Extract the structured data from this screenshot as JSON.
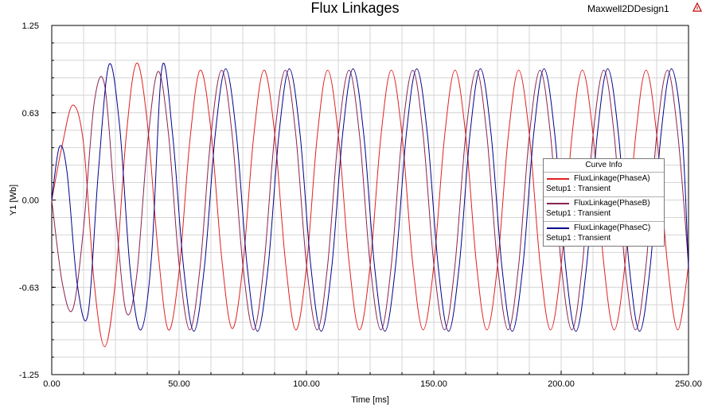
{
  "header": {
    "title": "Flux Linkages",
    "design_name": "Maxwell2DDesign1",
    "logo_icon": "ansys-triangle-icon"
  },
  "chart_data": {
    "type": "line",
    "title": "Flux Linkages",
    "xlabel": "Time [ms]",
    "ylabel": "Y1 [Wb]",
    "xlim": [
      0,
      250
    ],
    "ylim": [
      -1.25,
      1.25
    ],
    "x_ticks": [
      "0.00",
      "50.00",
      "100.00",
      "150.00",
      "200.00",
      "250.00"
    ],
    "y_ticks": [
      "1.25",
      "0.63",
      "0.00",
      "-0.63",
      "-1.25"
    ],
    "grid": true,
    "legend_position": "right",
    "legend_title": "Curve Info",
    "series": [
      {
        "name": "FluxLinkage(PhaseA)",
        "sublabel": "Setup1 : Transient",
        "color": "#e02020",
        "points": [
          [
            0,
            0.0
          ],
          [
            4.2,
            0.4
          ],
          [
            8.3,
            0.68
          ],
          [
            12.5,
            0.4
          ],
          [
            16.7,
            -0.6
          ],
          [
            20.8,
            -1.05
          ],
          [
            25,
            -0.58
          ],
          [
            29.2,
            0.45
          ],
          [
            33.3,
            0.98
          ],
          [
            37.5,
            0.56
          ],
          [
            41.7,
            -0.36
          ],
          [
            45.8,
            -0.93
          ],
          [
            50,
            -0.51
          ],
          [
            54.2,
            0.42
          ],
          [
            58.3,
            0.93
          ],
          [
            62.5,
            0.5
          ],
          [
            66.7,
            -0.41
          ],
          [
            70.8,
            -0.92
          ],
          [
            75,
            -0.48
          ],
          [
            79.2,
            0.44
          ],
          [
            83.3,
            0.93
          ],
          [
            87.5,
            0.48
          ],
          [
            91.7,
            -0.43
          ],
          [
            95.8,
            -0.93
          ],
          [
            100,
            -0.48
          ],
          [
            104.2,
            0.45
          ],
          [
            108.3,
            0.93
          ],
          [
            112.5,
            0.47
          ],
          [
            116.7,
            -0.44
          ],
          [
            120.8,
            -0.93
          ],
          [
            125,
            -0.47
          ],
          [
            129.2,
            0.45
          ],
          [
            133.3,
            0.93
          ],
          [
            137.5,
            0.47
          ],
          [
            141.7,
            -0.45
          ],
          [
            145.8,
            -0.93
          ],
          [
            150,
            -0.47
          ],
          [
            154.2,
            0.45
          ],
          [
            158.3,
            0.93
          ],
          [
            162.5,
            0.47
          ],
          [
            166.7,
            -0.45
          ],
          [
            170.8,
            -0.93
          ],
          [
            175,
            -0.47
          ],
          [
            179.2,
            0.45
          ],
          [
            183.3,
            0.93
          ],
          [
            187.5,
            0.47
          ],
          [
            191.7,
            -0.45
          ],
          [
            195.8,
            -0.93
          ],
          [
            200,
            -0.47
          ],
          [
            204.2,
            0.45
          ],
          [
            208.3,
            0.93
          ],
          [
            212.5,
            0.47
          ],
          [
            216.7,
            -0.45
          ],
          [
            220.8,
            -0.93
          ],
          [
            225,
            -0.47
          ],
          [
            229.2,
            0.45
          ],
          [
            233.3,
            0.93
          ],
          [
            237.5,
            0.47
          ],
          [
            241.7,
            -0.45
          ],
          [
            245.8,
            -0.93
          ],
          [
            250,
            -0.47
          ]
        ]
      },
      {
        "name": "FluxLinkage(PhaseB)",
        "sublabel": "Setup1 : Transient",
        "color": "#8b2252",
        "points": [
          [
            0,
            0.0
          ],
          [
            4.2,
            -0.6
          ],
          [
            8.3,
            -0.78
          ],
          [
            12.5,
            -0.2
          ],
          [
            16.7,
            0.7
          ],
          [
            20.8,
            0.82
          ],
          [
            25,
            -0.08
          ],
          [
            29.2,
            -0.8
          ],
          [
            33.3,
            -0.55
          ],
          [
            37.5,
            0.38
          ],
          [
            41.7,
            0.92
          ],
          [
            45.8,
            0.48
          ],
          [
            50,
            -0.46
          ],
          [
            54.2,
            -0.93
          ],
          [
            58.3,
            -0.47
          ],
          [
            62.5,
            0.46
          ],
          [
            66.7,
            0.93
          ],
          [
            70.8,
            0.47
          ],
          [
            75,
            -0.46
          ],
          [
            79.2,
            -0.93
          ],
          [
            83.3,
            -0.47
          ],
          [
            87.5,
            0.46
          ],
          [
            91.7,
            0.93
          ],
          [
            95.8,
            0.47
          ],
          [
            100,
            -0.46
          ],
          [
            104.2,
            -0.93
          ],
          [
            108.3,
            -0.47
          ],
          [
            112.5,
            0.46
          ],
          [
            116.7,
            0.93
          ],
          [
            120.8,
            0.47
          ],
          [
            125,
            -0.46
          ],
          [
            129.2,
            -0.93
          ],
          [
            133.3,
            -0.47
          ],
          [
            137.5,
            0.46
          ],
          [
            141.7,
            0.93
          ],
          [
            145.8,
            0.47
          ],
          [
            150,
            -0.46
          ],
          [
            154.2,
            -0.93
          ],
          [
            158.3,
            -0.47
          ],
          [
            162.5,
            0.46
          ],
          [
            166.7,
            0.93
          ],
          [
            170.8,
            0.47
          ],
          [
            175,
            -0.46
          ],
          [
            179.2,
            -0.93
          ],
          [
            183.3,
            -0.47
          ],
          [
            187.5,
            0.46
          ],
          [
            191.7,
            0.93
          ],
          [
            195.8,
            0.47
          ],
          [
            200,
            -0.46
          ],
          [
            204.2,
            -0.93
          ],
          [
            208.3,
            -0.47
          ],
          [
            212.5,
            0.46
          ],
          [
            216.7,
            0.93
          ],
          [
            220.8,
            0.47
          ],
          [
            225,
            -0.46
          ],
          [
            229.2,
            -0.93
          ],
          [
            233.3,
            -0.47
          ],
          [
            237.5,
            0.46
          ],
          [
            241.7,
            0.93
          ],
          [
            245.8,
            0.47
          ],
          [
            250,
            -0.46
          ]
        ]
      },
      {
        "name": "FluxLinkage(PhaseC)",
        "sublabel": "Setup1 : Transient",
        "color": "#00008b",
        "points": [
          [
            0,
            0.0
          ],
          [
            3,
            0.38
          ],
          [
            6,
            0.2
          ],
          [
            10,
            -0.6
          ],
          [
            14.2,
            -0.82
          ],
          [
            18.3,
            0.2
          ],
          [
            22.5,
            0.97
          ],
          [
            26.7,
            0.52
          ],
          [
            30.8,
            -0.5
          ],
          [
            35,
            -0.93
          ],
          [
            39.2,
            -0.4
          ],
          [
            43.3,
            0.95
          ],
          [
            47.5,
            0.46
          ],
          [
            51.7,
            -0.47
          ],
          [
            55.8,
            -0.94
          ],
          [
            60,
            -0.47
          ],
          [
            64.2,
            0.47
          ],
          [
            68.3,
            0.94
          ],
          [
            72.5,
            0.47
          ],
          [
            76.7,
            -0.47
          ],
          [
            80.8,
            -0.94
          ],
          [
            85,
            -0.47
          ],
          [
            89.2,
            0.47
          ],
          [
            93.3,
            0.94
          ],
          [
            97.5,
            0.47
          ],
          [
            101.7,
            -0.47
          ],
          [
            105.8,
            -0.94
          ],
          [
            110,
            -0.47
          ],
          [
            114.2,
            0.47
          ],
          [
            118.3,
            0.94
          ],
          [
            122.5,
            0.47
          ],
          [
            126.7,
            -0.47
          ],
          [
            130.8,
            -0.94
          ],
          [
            135,
            -0.47
          ],
          [
            139.2,
            0.47
          ],
          [
            143.3,
            0.94
          ],
          [
            147.5,
            0.47
          ],
          [
            151.7,
            -0.47
          ],
          [
            155.8,
            -0.94
          ],
          [
            160,
            -0.47
          ],
          [
            164.2,
            0.47
          ],
          [
            168.3,
            0.94
          ],
          [
            172.5,
            0.47
          ],
          [
            176.7,
            -0.47
          ],
          [
            180.8,
            -0.94
          ],
          [
            185,
            -0.47
          ],
          [
            189.2,
            0.47
          ],
          [
            193.3,
            0.94
          ],
          [
            197.5,
            0.47
          ],
          [
            201.7,
            -0.47
          ],
          [
            205.8,
            -0.94
          ],
          [
            210,
            -0.47
          ],
          [
            214.2,
            0.47
          ],
          [
            218.3,
            0.94
          ],
          [
            222.5,
            0.47
          ],
          [
            226.7,
            -0.47
          ],
          [
            230.8,
            -0.94
          ],
          [
            235,
            -0.47
          ],
          [
            239.2,
            0.47
          ],
          [
            243.3,
            0.94
          ],
          [
            247.5,
            0.47
          ],
          [
            250,
            -0.5
          ]
        ]
      }
    ]
  }
}
